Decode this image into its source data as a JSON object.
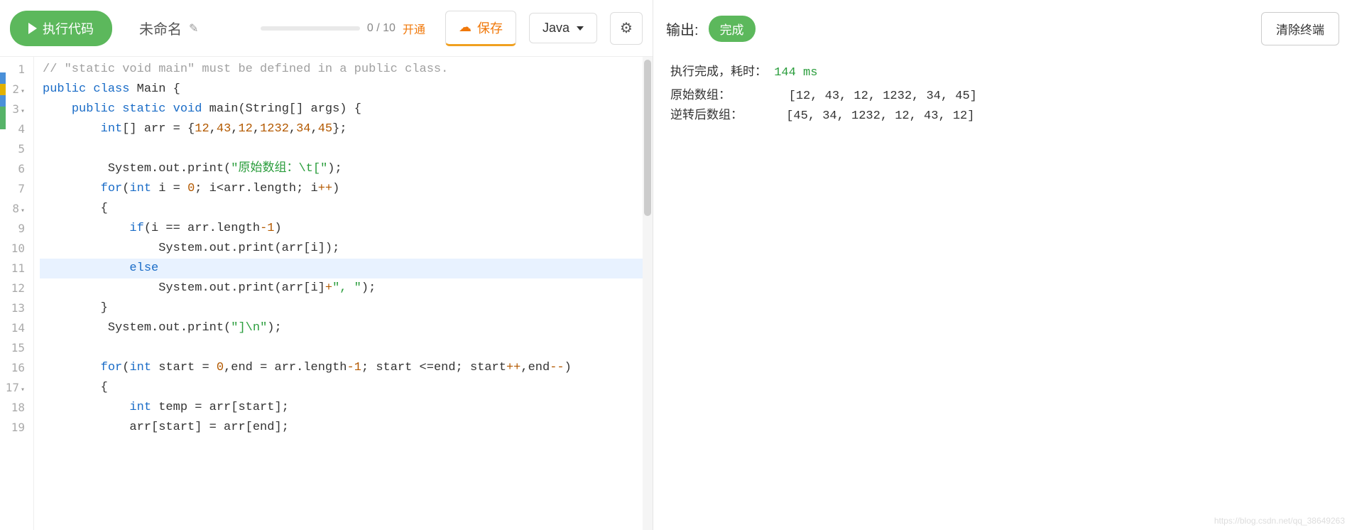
{
  "toolbar": {
    "run_label": "执行代码",
    "filename": "未命名",
    "progress_text": "0 / 10",
    "progress_link": "开通",
    "save_label": "保存",
    "language": "Java"
  },
  "code_lines": [
    {
      "n": 1,
      "fold": false,
      "highlight": false,
      "content": [
        {
          "c": "c-comment",
          "t": "// \"static void main\" must be defined in a public class."
        }
      ]
    },
    {
      "n": 2,
      "fold": true,
      "highlight": false,
      "content": [
        {
          "c": "c-keyword",
          "t": "public"
        },
        {
          "c": "",
          "t": " "
        },
        {
          "c": "c-keyword",
          "t": "class"
        },
        {
          "c": "",
          "t": " "
        },
        {
          "c": "c-id",
          "t": "Main {"
        }
      ]
    },
    {
      "n": 3,
      "fold": true,
      "highlight": false,
      "indent": "    ",
      "content": [
        {
          "c": "c-keyword",
          "t": "public"
        },
        {
          "c": "",
          "t": " "
        },
        {
          "c": "c-keyword",
          "t": "static"
        },
        {
          "c": "",
          "t": " "
        },
        {
          "c": "c-keyword",
          "t": "void"
        },
        {
          "c": "",
          "t": " "
        },
        {
          "c": "c-id",
          "t": "main(String[] args) {"
        }
      ]
    },
    {
      "n": 4,
      "fold": false,
      "highlight": false,
      "indent": "        ",
      "content": [
        {
          "c": "c-keyword",
          "t": "int"
        },
        {
          "c": "c-id",
          "t": "[] arr = {"
        },
        {
          "c": "c-number",
          "t": "12"
        },
        {
          "c": "c-id",
          "t": ","
        },
        {
          "c": "c-number",
          "t": "43"
        },
        {
          "c": "c-id",
          "t": ","
        },
        {
          "c": "c-number",
          "t": "12"
        },
        {
          "c": "c-id",
          "t": ","
        },
        {
          "c": "c-number",
          "t": "1232"
        },
        {
          "c": "c-id",
          "t": ","
        },
        {
          "c": "c-number",
          "t": "34"
        },
        {
          "c": "c-id",
          "t": ","
        },
        {
          "c": "c-number",
          "t": "45"
        },
        {
          "c": "c-id",
          "t": "};"
        }
      ]
    },
    {
      "n": 5,
      "fold": false,
      "highlight": false,
      "content": []
    },
    {
      "n": 6,
      "fold": false,
      "highlight": false,
      "indent": "         ",
      "content": [
        {
          "c": "c-id",
          "t": "System.out.print("
        },
        {
          "c": "c-string",
          "t": "\"原始数组：\\t[\""
        },
        {
          "c": "c-id",
          "t": ");"
        }
      ]
    },
    {
      "n": 7,
      "fold": false,
      "highlight": false,
      "indent": "        ",
      "content": [
        {
          "c": "c-keyword",
          "t": "for"
        },
        {
          "c": "c-id",
          "t": "("
        },
        {
          "c": "c-keyword",
          "t": "int"
        },
        {
          "c": "c-id",
          "t": " i = "
        },
        {
          "c": "c-number",
          "t": "0"
        },
        {
          "c": "c-id",
          "t": "; i<arr.length; i"
        },
        {
          "c": "c-op",
          "t": "++"
        },
        {
          "c": "c-id",
          "t": ")"
        }
      ]
    },
    {
      "n": 8,
      "fold": true,
      "highlight": false,
      "indent": "        ",
      "content": [
        {
          "c": "c-id",
          "t": "{"
        }
      ]
    },
    {
      "n": 9,
      "fold": false,
      "highlight": false,
      "indent": "            ",
      "content": [
        {
          "c": "c-keyword",
          "t": "if"
        },
        {
          "c": "c-id",
          "t": "(i == arr.length"
        },
        {
          "c": "c-op",
          "t": "-"
        },
        {
          "c": "c-number",
          "t": "1"
        },
        {
          "c": "c-id",
          "t": ")"
        }
      ]
    },
    {
      "n": 10,
      "fold": false,
      "highlight": false,
      "indent": "                ",
      "content": [
        {
          "c": "c-id",
          "t": "System.out.print(arr[i]);"
        }
      ]
    },
    {
      "n": 11,
      "fold": false,
      "highlight": true,
      "indent": "            ",
      "content": [
        {
          "c": "c-keyword",
          "t": "else"
        }
      ]
    },
    {
      "n": 12,
      "fold": false,
      "highlight": false,
      "indent": "                ",
      "content": [
        {
          "c": "c-id",
          "t": "System.out.print(arr[i]"
        },
        {
          "c": "c-op",
          "t": "+"
        },
        {
          "c": "c-string",
          "t": "\", \""
        },
        {
          "c": "c-id",
          "t": ");"
        }
      ]
    },
    {
      "n": 13,
      "fold": false,
      "highlight": false,
      "indent": "        ",
      "content": [
        {
          "c": "c-id",
          "t": "}"
        }
      ]
    },
    {
      "n": 14,
      "fold": false,
      "highlight": false,
      "indent": "         ",
      "content": [
        {
          "c": "c-id",
          "t": "System.out.print("
        },
        {
          "c": "c-string",
          "t": "\"]\\n\""
        },
        {
          "c": "c-id",
          "t": ");"
        }
      ]
    },
    {
      "n": 15,
      "fold": false,
      "highlight": false,
      "content": []
    },
    {
      "n": 16,
      "fold": false,
      "highlight": false,
      "indent": "        ",
      "content": [
        {
          "c": "c-keyword",
          "t": "for"
        },
        {
          "c": "c-id",
          "t": "("
        },
        {
          "c": "c-keyword",
          "t": "int"
        },
        {
          "c": "c-id",
          "t": " start = "
        },
        {
          "c": "c-number",
          "t": "0"
        },
        {
          "c": "c-id",
          "t": ",end = arr.length"
        },
        {
          "c": "c-op",
          "t": "-"
        },
        {
          "c": "c-number",
          "t": "1"
        },
        {
          "c": "c-id",
          "t": "; start <=end; start"
        },
        {
          "c": "c-op",
          "t": "++"
        },
        {
          "c": "c-id",
          "t": ",end"
        },
        {
          "c": "c-op",
          "t": "--"
        },
        {
          "c": "c-id",
          "t": ")"
        }
      ]
    },
    {
      "n": 17,
      "fold": true,
      "highlight": false,
      "indent": "        ",
      "content": [
        {
          "c": "c-id",
          "t": "{"
        }
      ]
    },
    {
      "n": 18,
      "fold": false,
      "highlight": false,
      "indent": "            ",
      "content": [
        {
          "c": "c-keyword",
          "t": "int"
        },
        {
          "c": "c-id",
          "t": " temp = arr[start];"
        }
      ]
    },
    {
      "n": 19,
      "fold": false,
      "highlight": false,
      "indent": "            ",
      "content": [
        {
          "c": "c-id",
          "t": "arr[start] = arr[end];"
        }
      ]
    }
  ],
  "output": {
    "title": "输出:",
    "status": "完成",
    "clear_label": "清除终端",
    "exec_prefix": "执行完成，耗时：",
    "exec_time": "144 ms",
    "lines": [
      "原始数组：        [12, 43, 12, 1232, 34, 45]",
      "逆转后数组：      [45, 34, 1232, 12, 43, 12]"
    ]
  },
  "watermark": "https://blog.csdn.net/qq_38649263"
}
